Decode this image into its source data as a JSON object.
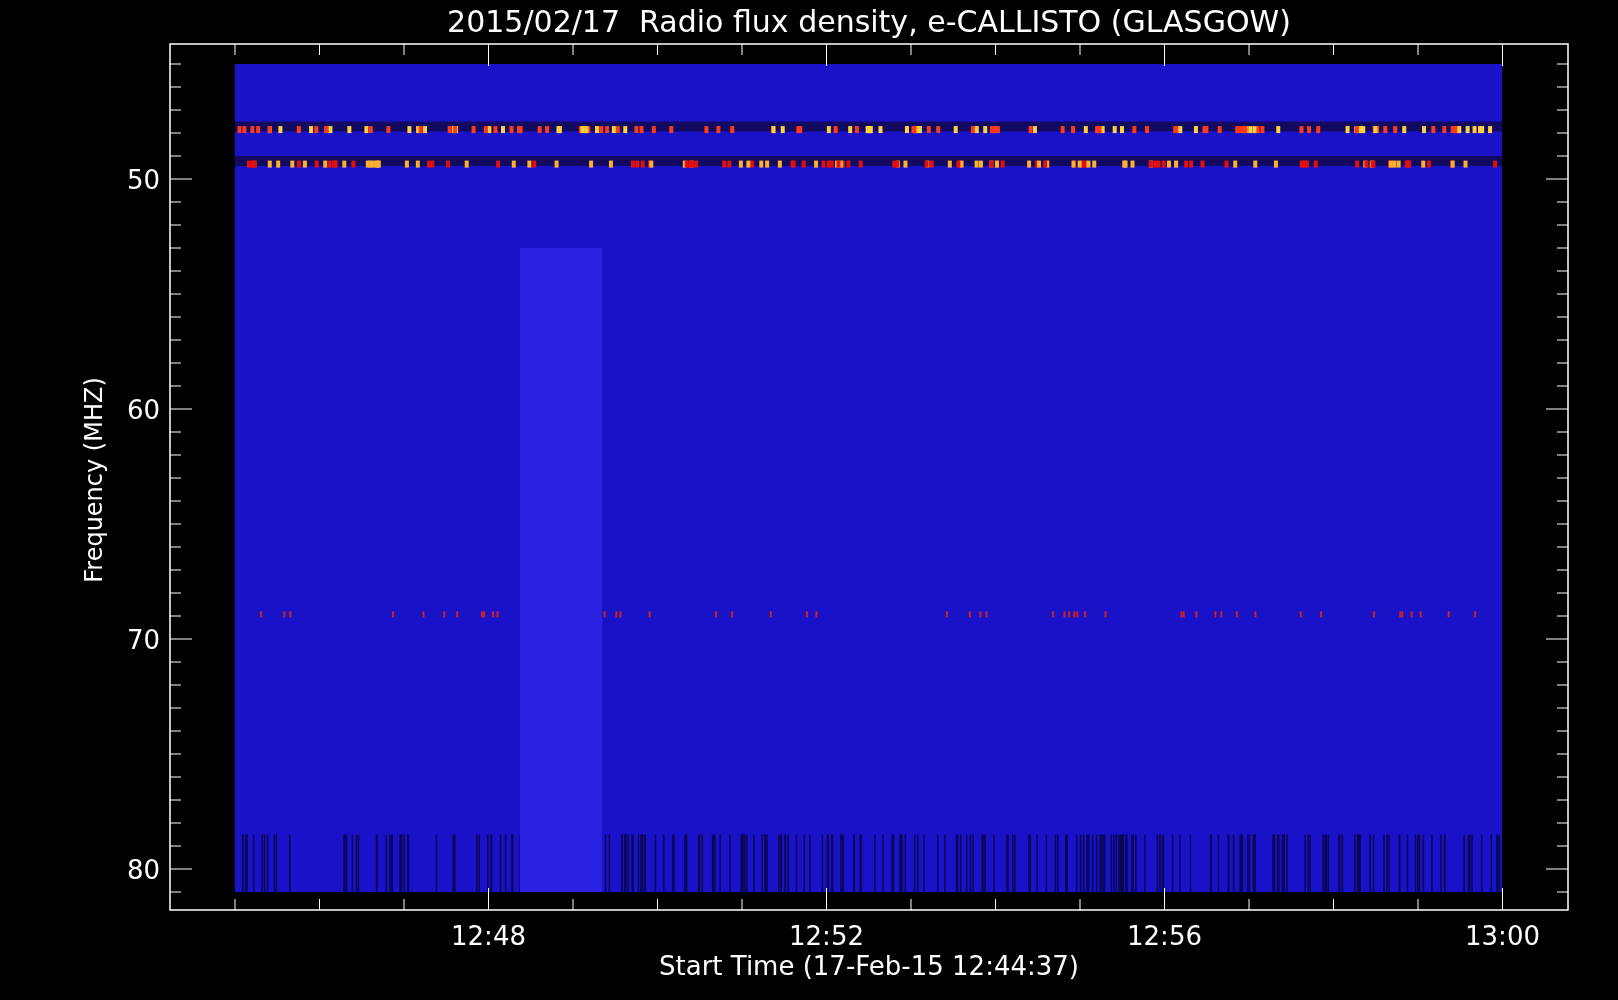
{
  "title": "2015/02/17  Radio flux density, e-CALLISTO (GLASGOW)",
  "ylabel": "Frequency (MHZ)",
  "xlabel": "Start Time (17-Feb-15 12:44:37)",
  "yticks": [
    "50",
    "60",
    "70",
    "80"
  ],
  "xticks": [
    "12:48",
    "12:52",
    "12:56",
    "13:00"
  ]
}
